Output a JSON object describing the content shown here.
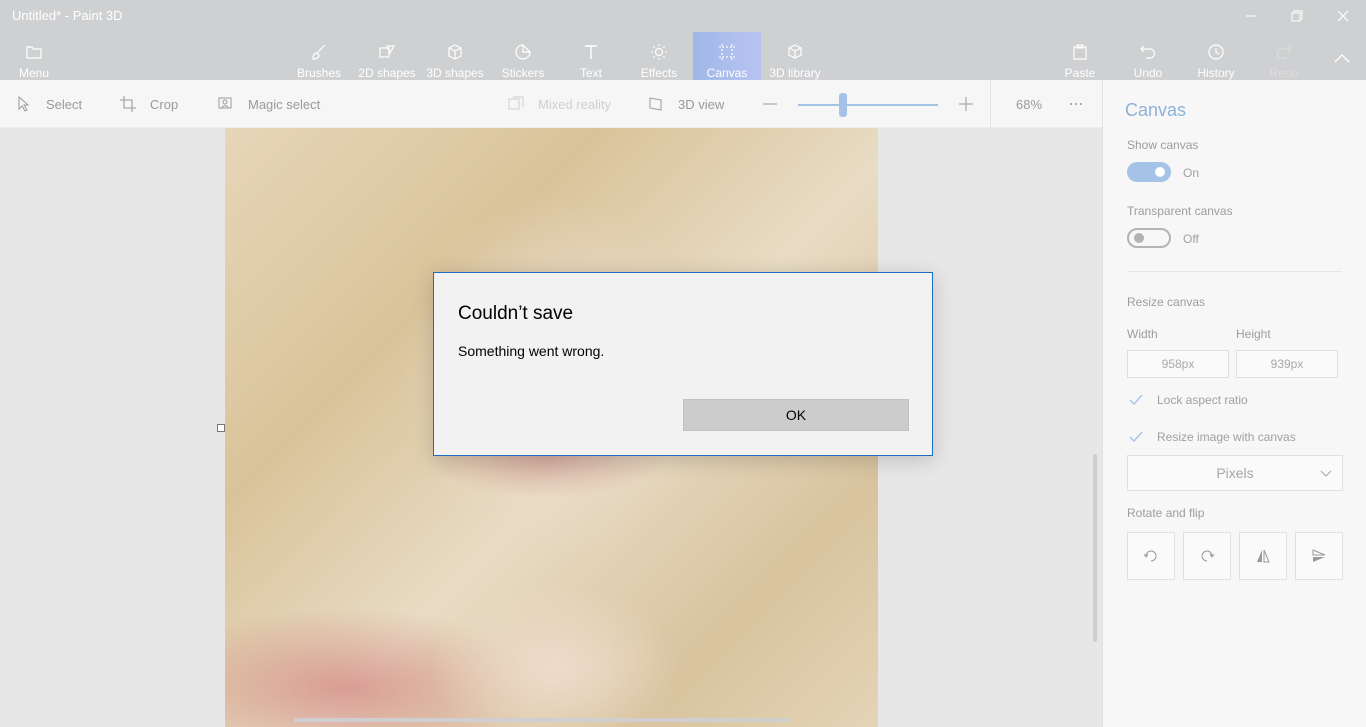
{
  "window": {
    "title": "Untitled* - Paint 3D"
  },
  "ribbon": {
    "menu": "Menu",
    "tools": [
      {
        "label": "Brushes",
        "icon": "brush-icon"
      },
      {
        "label": "2D shapes",
        "icon": "2d-shapes-icon"
      },
      {
        "label": "3D shapes",
        "icon": "3d-cube-icon"
      },
      {
        "label": "Stickers",
        "icon": "sticker-icon"
      },
      {
        "label": "Text",
        "icon": "text-icon"
      },
      {
        "label": "Effects",
        "icon": "sun-icon"
      },
      {
        "label": "Canvas",
        "icon": "canvas-icon",
        "active": true
      },
      {
        "label": "3D library",
        "icon": "3d-library-icon"
      }
    ],
    "paste": "Paste",
    "undo": "Undo",
    "history": "History",
    "redo": "Redo"
  },
  "toolbar": {
    "select": "Select",
    "crop": "Crop",
    "magic_select": "Magic select",
    "mixed_reality": "Mixed reality",
    "view_3d": "3D view",
    "zoom_percent": "68%",
    "zoom_level": 0.32
  },
  "panel": {
    "title": "Canvas",
    "show_canvas_label": "Show canvas",
    "show_canvas_state": "On",
    "transparent_label": "Transparent canvas",
    "transparent_state": "Off",
    "resize_label": "Resize canvas",
    "width_label": "Width",
    "height_label": "Height",
    "width_value": "958px",
    "height_value": "939px",
    "lock_aspect": "Lock aspect ratio",
    "resize_image": "Resize image with canvas",
    "units": "Pixels",
    "rotate_label": "Rotate and flip"
  },
  "dialog": {
    "title": "Couldn’t save",
    "message": "Something went wrong.",
    "ok": "OK"
  },
  "colors": {
    "accent": "#a5c3e6",
    "dialog_border": "#1b6ec2"
  }
}
